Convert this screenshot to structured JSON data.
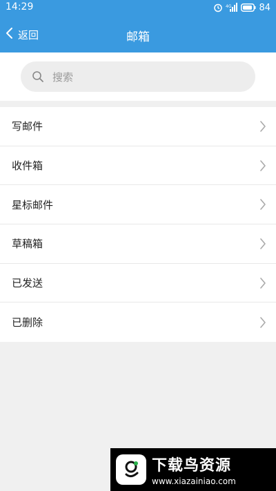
{
  "status_bar": {
    "time": "14:29",
    "signal_label": "4G",
    "battery": "84"
  },
  "nav": {
    "back_label": "返回",
    "title": "邮箱"
  },
  "search": {
    "placeholder": "搜索"
  },
  "menu": {
    "items": [
      {
        "label": "写邮件"
      },
      {
        "label": "收件箱"
      },
      {
        "label": "星标邮件"
      },
      {
        "label": "草稿箱"
      },
      {
        "label": "已发送"
      },
      {
        "label": "已删除"
      }
    ]
  },
  "watermark": {
    "title": "下载鸟资源",
    "url": "www.xiazainiao.com"
  },
  "colors": {
    "header": "#3a9ae0",
    "background": "#f0f0f0"
  }
}
